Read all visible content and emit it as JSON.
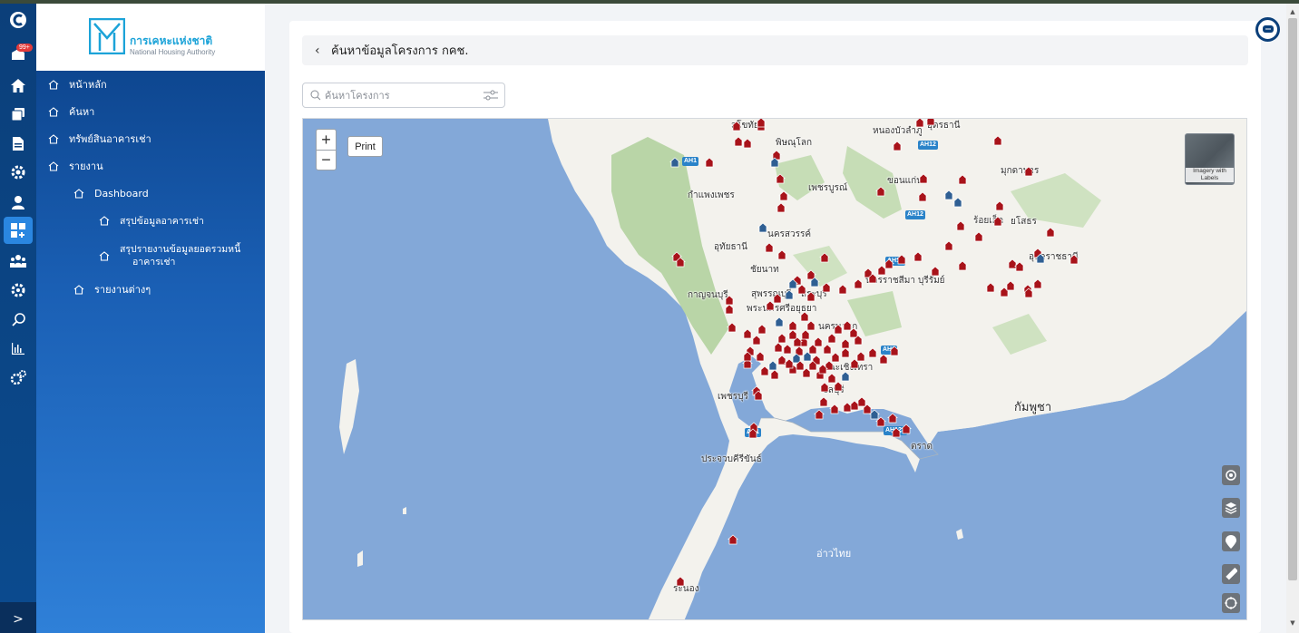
{
  "rail": {
    "badge": "99+",
    "icons": [
      "app-logo-icon",
      "inbox-icon",
      "home-icon",
      "layers-icon",
      "document-icon",
      "settings-gear-icon",
      "user-icon",
      "dashboard-icon",
      "group-icon",
      "gear-icon",
      "search-icon",
      "bar-chart-icon",
      "admin-settings-icon"
    ],
    "expand_label": ">"
  },
  "logo": {
    "thai": "การเคหะแห่งชาติ",
    "english": "National Housing Authority"
  },
  "nav": {
    "home": "หน้าหลัก",
    "search": "ค้นหา",
    "rental_assets": "ทรัพย์สินอาคารเช่า",
    "report": "รายงาน",
    "dashboard": "Dashboard",
    "rental_summary": "สรุปข้อมูลอาคารเช่า",
    "debt_summary_line1": "สรุปรายงานข้อมูลยอดรวมหนี้",
    "debt_summary_line2": "อาคารเช่า",
    "other_reports": "รายงานต่างๆ"
  },
  "header": {
    "back": "‹",
    "title": "ค้นหาข้อมูลโครงการ กคช."
  },
  "search": {
    "placeholder": "ค้นหาโครงการ",
    "value": ""
  },
  "map": {
    "zoom_in": "+",
    "zoom_out": "−",
    "print": "Print",
    "imagery_label": "Imagery with Labels",
    "labels": {
      "sukhothai": "สุโขทัย",
      "phitsanulok": "พิษณุโลก",
      "nongbua": "หนองบัวลำภู",
      "udon": "อุดรธานี",
      "mukdahan": "มุกดาหาร",
      "phetchabun": "เพชรบูรณ์",
      "khonkaen": "ขอนแก่น",
      "kamphaeng": "กำแพงเพชร",
      "roiet": "ร้อยเอ็ด",
      "yasothon": "ยโสธร",
      "nakhonsawan": "นครสวรรค์",
      "uthai": "อุทัยธานี",
      "chainat": "ชัยนาท",
      "korat": "นครราชสีมา",
      "buriram": "บุรีรัมย์",
      "ubon": "อุบลราชธานี",
      "kanchanaburi": "กาญจนบุรี",
      "suphanburi": "สุพรรณบุรี",
      "ayutthaya": "พระนครศรีอยุธยา",
      "saraburi": "สระบุรี",
      "nakhonnayok": "นครนายก",
      "chachoengsao": "ฉะเชิงเทรา",
      "chonburi": "ชลบุรี",
      "phetchaburi": "เพชรบุรี",
      "cambodia": "กัมพูชา",
      "prachuap": "ประจวบคีรีขันธ์",
      "trat": "ตราด",
      "gulf": "อ่าวไทย",
      "ranong": "ระนอง"
    },
    "roads": [
      "AH1",
      "AH12",
      "AH12",
      "AH12",
      "AH1",
      "AH1",
      "AH2",
      "AH123"
    ]
  },
  "colors": {
    "sea": "#83a8d8",
    "land": "#f3f2ed",
    "forest": "#b9d5a7",
    "pin_red": "#a8131a",
    "pin_blue": "#2f5f93",
    "sidebar_top": "#0a3f85",
    "sidebar_bottom": "#2f80d8"
  }
}
